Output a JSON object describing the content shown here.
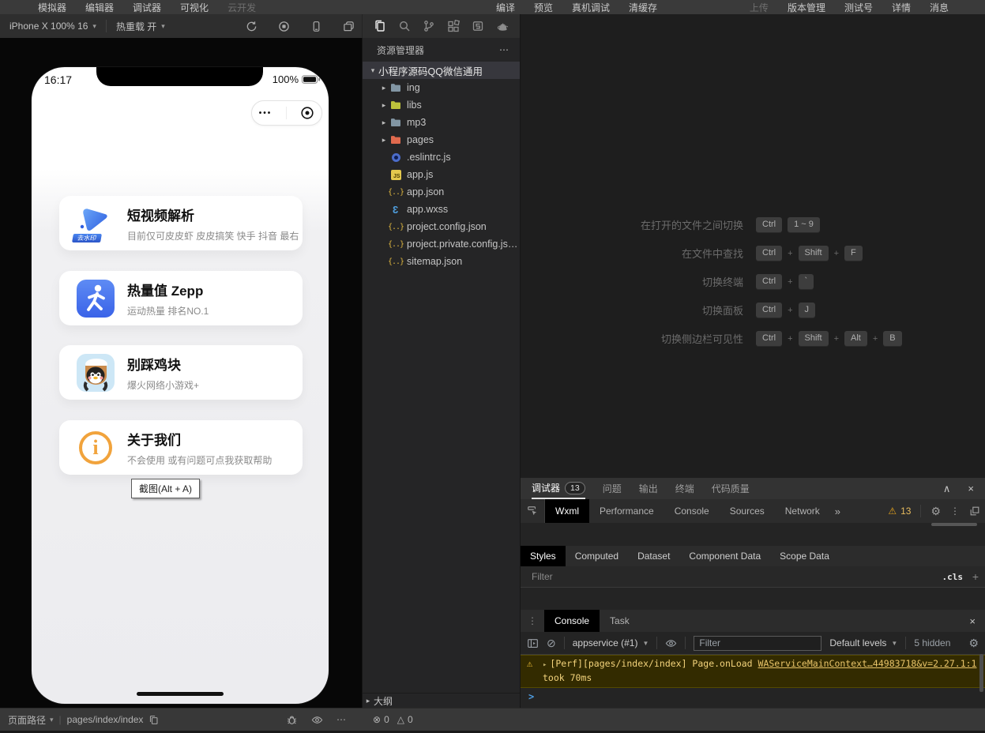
{
  "icons": {
    "plus": "+",
    "caret_down": "▾",
    "caret_right": "▸",
    "dropdown": "▼",
    "overflow": "⋯",
    "kebab": "⋮",
    "more_tabs": "»",
    "collapse": "∧",
    "close": "×",
    "clear": "⊘",
    "gear": "⚙",
    "warning": "⚠",
    "circle_cross": "⊗",
    "triangle": "△",
    "capsule_dots": "•••",
    "prompt": ">",
    "pipe": "|"
  },
  "menu_bar": {
    "left": [
      "模拟器",
      "编辑器",
      "调试器",
      "可视化",
      "云开发"
    ],
    "center": [
      "编译",
      "预览",
      "真机调试",
      "清缓存"
    ],
    "right": [
      "上传",
      "版本管理",
      "测试号",
      "详情",
      "消息"
    ]
  },
  "simulator_toolbar": {
    "device": "iPhone X 100% 16",
    "hot_reload": "热重载 开"
  },
  "phone": {
    "time": "16:17",
    "battery_percent": "100%",
    "cards": [
      {
        "title": "短视频解析",
        "subtitle": "目前仅可皮皮虾 皮皮搞笑 快手 抖音 最右",
        "icon_badge": "去水印"
      },
      {
        "title": "热量值 Zepp",
        "subtitle": "运动热量 排名NO.1"
      },
      {
        "title": "别踩鸡块",
        "subtitle": "爆火网络小游戏+"
      },
      {
        "title": "关于我们",
        "subtitle": "不会使用 或有问题可点我获取帮助"
      }
    ],
    "tooltip": "截图(Alt + A)"
  },
  "explorer": {
    "title": "资源管理器",
    "root": "小程序源码QQ微信通用",
    "folders": [
      "ing",
      "libs",
      "mp3",
      "pages"
    ],
    "files": [
      ".eslintrc.js",
      "app.js",
      "app.json",
      "app.wxss",
      "project.config.json",
      "project.private.config.js…",
      "sitemap.json"
    ],
    "outline": "大纲"
  },
  "shortcuts": {
    "rows": [
      {
        "label": "在打开的文件之间切换",
        "k1": "Ctrl",
        "k2": "1 ~ 9"
      },
      {
        "label": "在文件中查找",
        "k1": "Ctrl",
        "k2": "Shift",
        "k3": "F"
      },
      {
        "label": "切换终端",
        "k1": "Ctrl",
        "k2": "`"
      },
      {
        "label": "切换面板",
        "k1": "Ctrl",
        "k2": "J"
      },
      {
        "label": "切换侧边栏可见性",
        "k1": "Ctrl",
        "k2": "Shift",
        "k3": "Alt",
        "k4": "B"
      }
    ]
  },
  "debugger": {
    "panel_tabs": [
      "调试器",
      "问题",
      "输出",
      "终端",
      "代码质量"
    ],
    "debugger_badge": "13",
    "devtools_tabs": [
      "Wxml",
      "Performance",
      "Console",
      "Sources",
      "Network"
    ],
    "warning_count": "13",
    "styles_tabs": [
      "Styles",
      "Computed",
      "Dataset",
      "Component Data",
      "Scope Data"
    ],
    "styles_filter_placeholder": "Filter",
    "cls_toggle": ".cls",
    "console_tabs": [
      "Console",
      "Task"
    ],
    "context_selector": "appservice (#1)",
    "console_filter_placeholder": "Filter",
    "levels_selector": "Default levels",
    "hidden_count": "5 hidden",
    "warning": {
      "prefix": "[Perf][pages/index/index] Page.onLoad ",
      "link": "WAServiceMainContext…44983718&v=2.27.1:1",
      "line2": "took 70ms"
    }
  },
  "status_bar": {
    "path_label": "页面路径",
    "path_value": "pages/index/index",
    "error_count": "0",
    "warning_count": "0"
  }
}
